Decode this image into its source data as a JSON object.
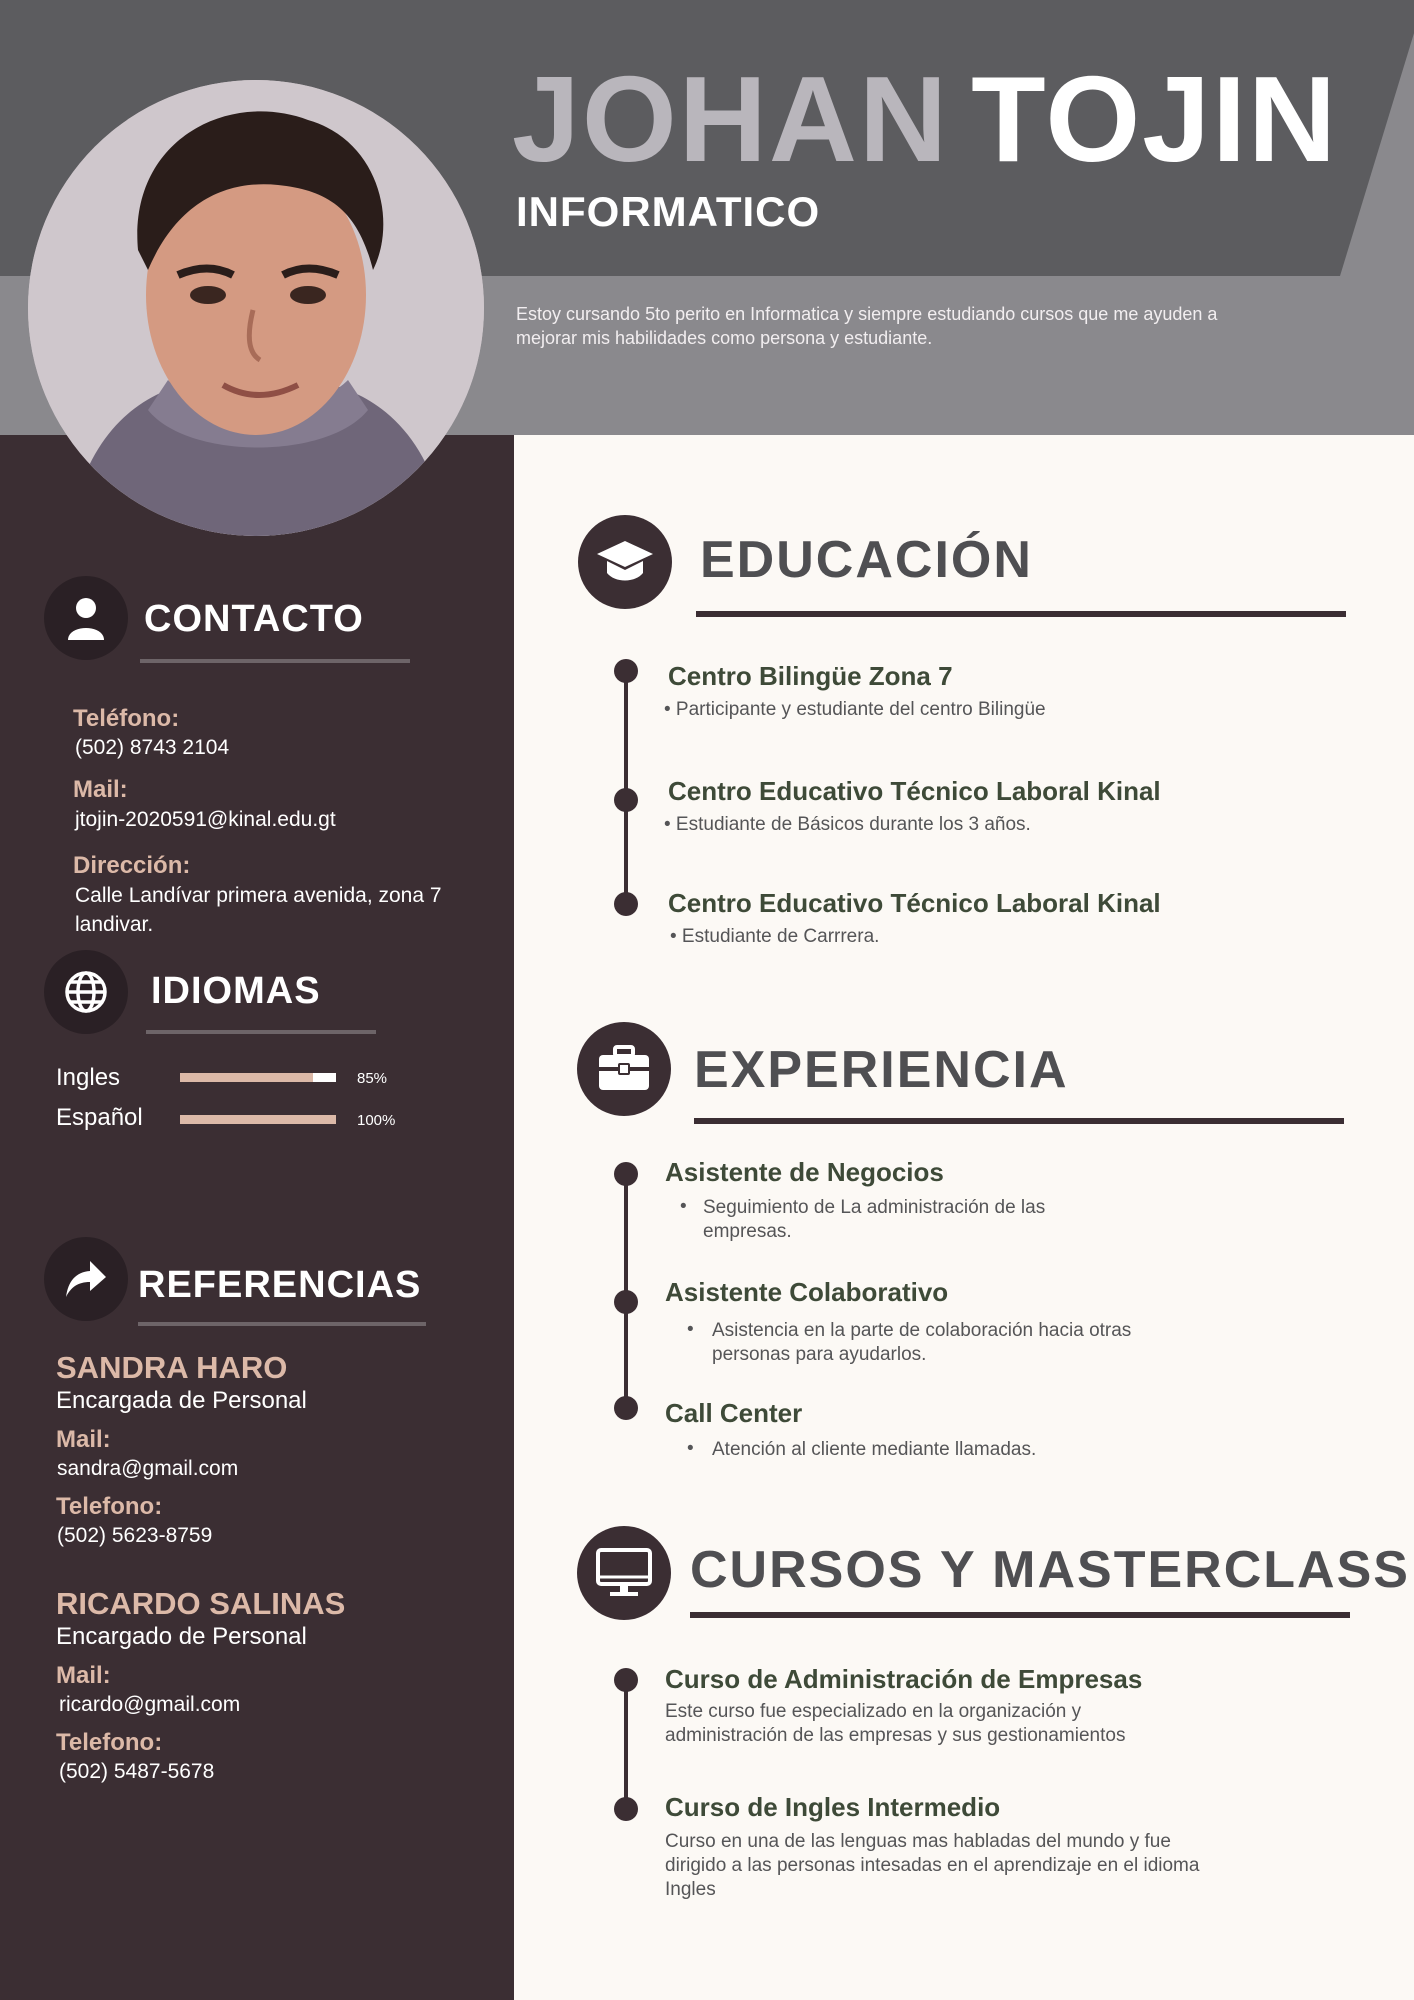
{
  "header": {
    "first_name": "JOHAN",
    "last_name": "TOJIN",
    "role": "INFORMATICO",
    "summary": "Estoy cursando 5to perito en Informatica y siempre estudiando cursos que me ayuden a mejorar mis habilidades como persona y estudiante."
  },
  "contact": {
    "title": "CONTACTO",
    "phone_label": "Teléfono:",
    "phone": "(502) 8743 2104",
    "mail_label": "Mail:",
    "mail": "jtojin-2020591@kinal.edu.gt",
    "address_label": "Dirección:",
    "address": "Calle Landívar primera avenida, zona 7 landivar."
  },
  "languages": {
    "title": "IDIOMAS",
    "items": [
      {
        "name": "Ingles",
        "percent_label": "85%",
        "level": 0.85
      },
      {
        "name": "Español",
        "percent_label": "100%",
        "level": 1.0
      }
    ]
  },
  "references": {
    "title": "REFERENCIAS",
    "items": [
      {
        "name": "SANDRA HARO",
        "role": "Encargada de Personal",
        "mail_label": "Mail:",
        "mail": "sandra@gmail.com",
        "phone_label": "Telefono:",
        "phone": "(502) 5623-8759"
      },
      {
        "name": "RICARDO SALINAS",
        "role": "Encargado de Personal",
        "mail_label": "Mail:",
        "mail": "ricardo@gmail.com",
        "phone_label": "Telefono:",
        "phone": "(502) 5487-5678"
      }
    ]
  },
  "education": {
    "title": "EDUCACIÓN",
    "items": [
      {
        "title": "Centro Bilingüe Zona 7",
        "text": "• Participante y estudiante del centro Bilingüe"
      },
      {
        "title": "Centro Educativo Técnico Laboral Kinal",
        "text": "• Estudiante de Básicos durante los 3 años."
      },
      {
        "title": "Centro Educativo Técnico Laboral Kinal",
        "text": "• Estudiante de Carrrera."
      }
    ]
  },
  "experience": {
    "title": "EXPERIENCIA",
    "items": [
      {
        "title": "Asistente de Negocios",
        "text": "Seguimiento de La administración de las empresas."
      },
      {
        "title": "Asistente Colaborativo",
        "text": "Asistencia en la parte de colaboración hacia otras personas para ayudarlos."
      },
      {
        "title": "Call Center",
        "text": "Atención al cliente mediante llamadas."
      }
    ]
  },
  "courses": {
    "title": "CURSOS Y MASTERCLASS",
    "items": [
      {
        "title": "Curso de Administración de Empresas",
        "text": "Este curso fue especializado en la organización y administración de las empresas y sus gestionamientos"
      },
      {
        "title": "Curso de Ingles Intermedio",
        "text": "Curso en una de las lenguas mas habladas del mundo y fue dirigido a las personas intesadas en el aprendizaje en el idioma Ingles"
      }
    ]
  },
  "colors": {
    "sidebar": "#3b2e33",
    "accent": "#dcb9a8",
    "header_dark": "#5c5c5f",
    "header_light": "#8a898d",
    "item_title": "#3e4a38"
  },
  "icons": [
    "user-icon",
    "globe-icon",
    "share-arrow-icon",
    "graduation-cap-icon",
    "briefcase-icon",
    "monitor-icon"
  ]
}
